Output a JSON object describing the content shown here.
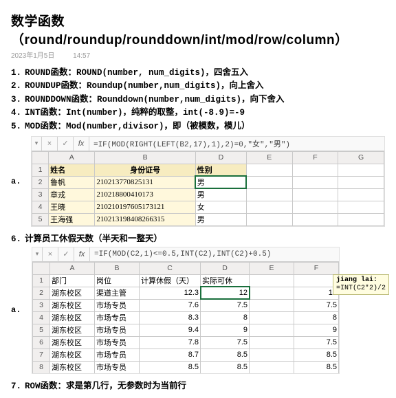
{
  "title": "数学函数（round/roundup/rounddown/int/mod/row/column）",
  "meta": {
    "date": "2023年1月5日",
    "time": "14:57"
  },
  "items": {
    "n1": "1.",
    "t1": "ROUND函数：ROUND(number, num_digits)，四舍五入",
    "n2": "2.",
    "t2": "ROUNDUP函数：Roundup(number,num_digits)，向上舍入",
    "n3": "3.",
    "t3": "ROUNDDOWN函数：Rounddown(number,num_digits)，向下舍入",
    "n4": "4.",
    "t4": "INT函数：Int(number)，纯粹的取整，int(-8.9)=-9",
    "n5": "5.",
    "t5": "MOD函数：Mod(number,divisor)，即（被模数，模儿）",
    "n6": "6.",
    "t6": "计算员工休假天数（半天和一整天）",
    "n7": "7.",
    "t7": "ROW函数：求是第几行，无参数时为当前行"
  },
  "fbar1": {
    "x": "×",
    "v": "✓",
    "fx": "fx",
    "formula": "=IF(MOD(RIGHT(LEFT(B2,17),1),2)=0,\"女\",\"男\")"
  },
  "fbar2": {
    "x": "×",
    "v": "✓",
    "fx": "fx",
    "formula": "=IF(MOD(C2,1)<=0.5,INT(C2),INT(C2)+0.5)"
  },
  "cols": {
    "A": "A",
    "B": "B",
    "C": "C",
    "D": "D",
    "E": "E",
    "F": "F",
    "G": "G"
  },
  "t1": {
    "h": {
      "name": "姓名",
      "id": "身份证号",
      "sex": "性别"
    },
    "r2": {
      "n": "2",
      "name": "鲁帆",
      "id": "210213770825131",
      "sex": "男"
    },
    "r3": {
      "n": "3",
      "name": "章戎",
      "id": "210218800410173",
      "sex": "男"
    },
    "r4": {
      "n": "4",
      "name": "王晓",
      "id": "210210197605173121",
      "sex": "女"
    },
    "r5": {
      "n": "5",
      "name": "王海强",
      "id": "210213198408266315",
      "sex": "男"
    }
  },
  "t2": {
    "h": {
      "dept": "部门",
      "post": "岗位",
      "calc": "计算休假（天）",
      "actual": "实际可休"
    },
    "rows": {
      "r2": {
        "n": "2",
        "dept": "湖东校区",
        "post": "渠道主管",
        "c": "12.3",
        "d": "12",
        "e": "",
        "f": "12"
      },
      "r3": {
        "n": "3",
        "dept": "湖东校区",
        "post": "市场专员",
        "c": "7.6",
        "d": "7.5",
        "e": "",
        "f": "7.5"
      },
      "r4": {
        "n": "4",
        "dept": "湖东校区",
        "post": "市场专员",
        "c": "8.3",
        "d": "8",
        "e": "",
        "f": "8"
      },
      "r5": {
        "n": "5",
        "dept": "湖东校区",
        "post": "市场专员",
        "c": "9.4",
        "d": "9",
        "e": "",
        "f": "9"
      },
      "r6": {
        "n": "6",
        "dept": "湖东校区",
        "post": "市场专员",
        "c": "7.8",
        "d": "7.5",
        "e": "",
        "f": "7.5"
      },
      "r7": {
        "n": "7",
        "dept": "湖东校区",
        "post": "市场专员",
        "c": "8.7",
        "d": "8.5",
        "e": "",
        "f": "8.5"
      },
      "r8": {
        "n": "8",
        "dept": "湖东校区",
        "post": "市场专员",
        "c": "8.5",
        "d": "8.5",
        "e": "",
        "f": "8.5"
      }
    }
  },
  "marks": {
    "a": "a."
  },
  "note": {
    "author": "jiang lai:",
    "text": "=INT(C2*2)/2"
  }
}
